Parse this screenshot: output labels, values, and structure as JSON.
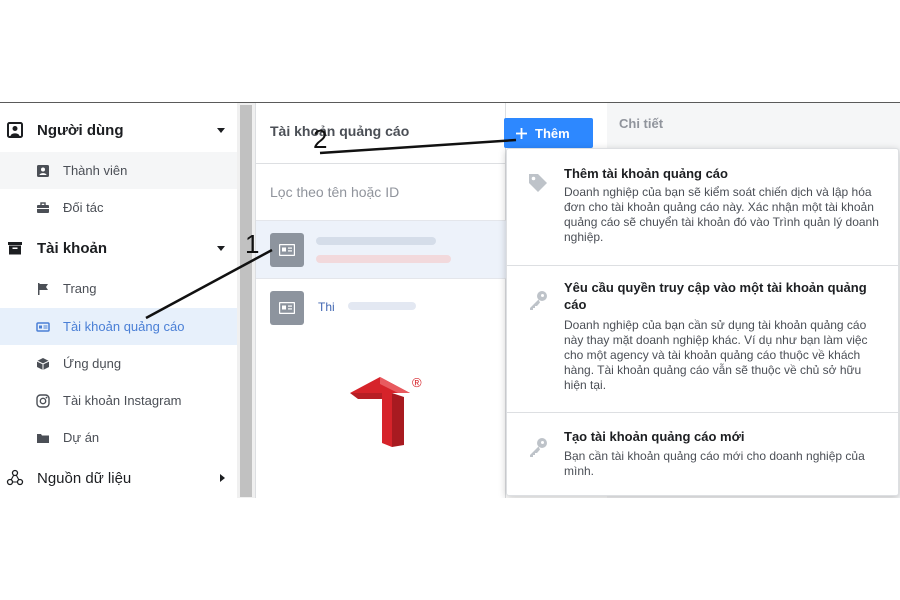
{
  "sidebar": {
    "sections": [
      {
        "label": "Người dùng",
        "icon": "user-list-icon",
        "expanded": true
      },
      {
        "label": "Tài khoản",
        "icon": "briefcase-icon",
        "expanded": true
      },
      {
        "label": "Nguồn dữ liệu",
        "icon": "data-sources-icon",
        "expanded": false
      }
    ],
    "users_items": [
      {
        "label": "Thành viên",
        "icon": "id-card-icon"
      },
      {
        "label": "Đối tác",
        "icon": "toolbox-icon"
      }
    ],
    "account_items": [
      {
        "label": "Trang",
        "icon": "flag-icon"
      },
      {
        "label": "Tài khoản quảng cáo",
        "icon": "ad-account-icon",
        "active": true
      },
      {
        "label": "Ứng dụng",
        "icon": "cube-icon"
      },
      {
        "label": "Tài khoản Instagram",
        "icon": "instagram-icon"
      },
      {
        "label": "Dự án",
        "icon": "folder-icon"
      }
    ]
  },
  "list_panel": {
    "title": "Tài khoản quảng cáo",
    "filter_placeholder": "Lọc theo tên hoặc ID",
    "accounts": [
      {
        "name": "",
        "selected": true
      },
      {
        "name": "Thi",
        "selected": false
      }
    ]
  },
  "add_button": {
    "label": "Thêm",
    "icon": "plus-icon"
  },
  "detail": {
    "title": "Chi tiết"
  },
  "dropdown": {
    "options": [
      {
        "icon": "tag-icon",
        "title": "Thêm tài khoản quảng cáo",
        "description": "Doanh nghiệp của bạn sẽ kiểm soát chiến dịch và lập hóa đơn cho tài khoản quảng cáo này. Xác nhận một tài khoản quảng cáo sẽ chuyển tài khoản đó vào Trình quản lý doanh nghiệp."
      },
      {
        "icon": "key-icon",
        "title": "Yêu cầu quyền truy cập vào một tài khoản quảng cáo",
        "description": "Doanh nghiệp của bạn cần sử dụng tài khoản quảng cáo này thay mặt doanh nghiệp khác. Ví dụ như bạn làm việc cho một agency và tài khoản quảng cáo thuộc về khách hàng. Tài khoản quảng cáo vẫn sẽ thuộc về chủ sở hữu hiện tại."
      },
      {
        "icon": "key-icon",
        "title": "Tạo tài khoản quảng cáo mới",
        "description": "Bạn cần tài khoản quảng cáo mới cho doanh nghiệp của mình."
      }
    ]
  },
  "annotations": {
    "marker_1": "1",
    "marker_2": "2"
  },
  "logo": {
    "mark": "®",
    "color": "#d6232a"
  },
  "colors": {
    "accent": "#2d88ff",
    "active_text": "#4a7fd6",
    "active_bg": "#e7f0fb"
  }
}
